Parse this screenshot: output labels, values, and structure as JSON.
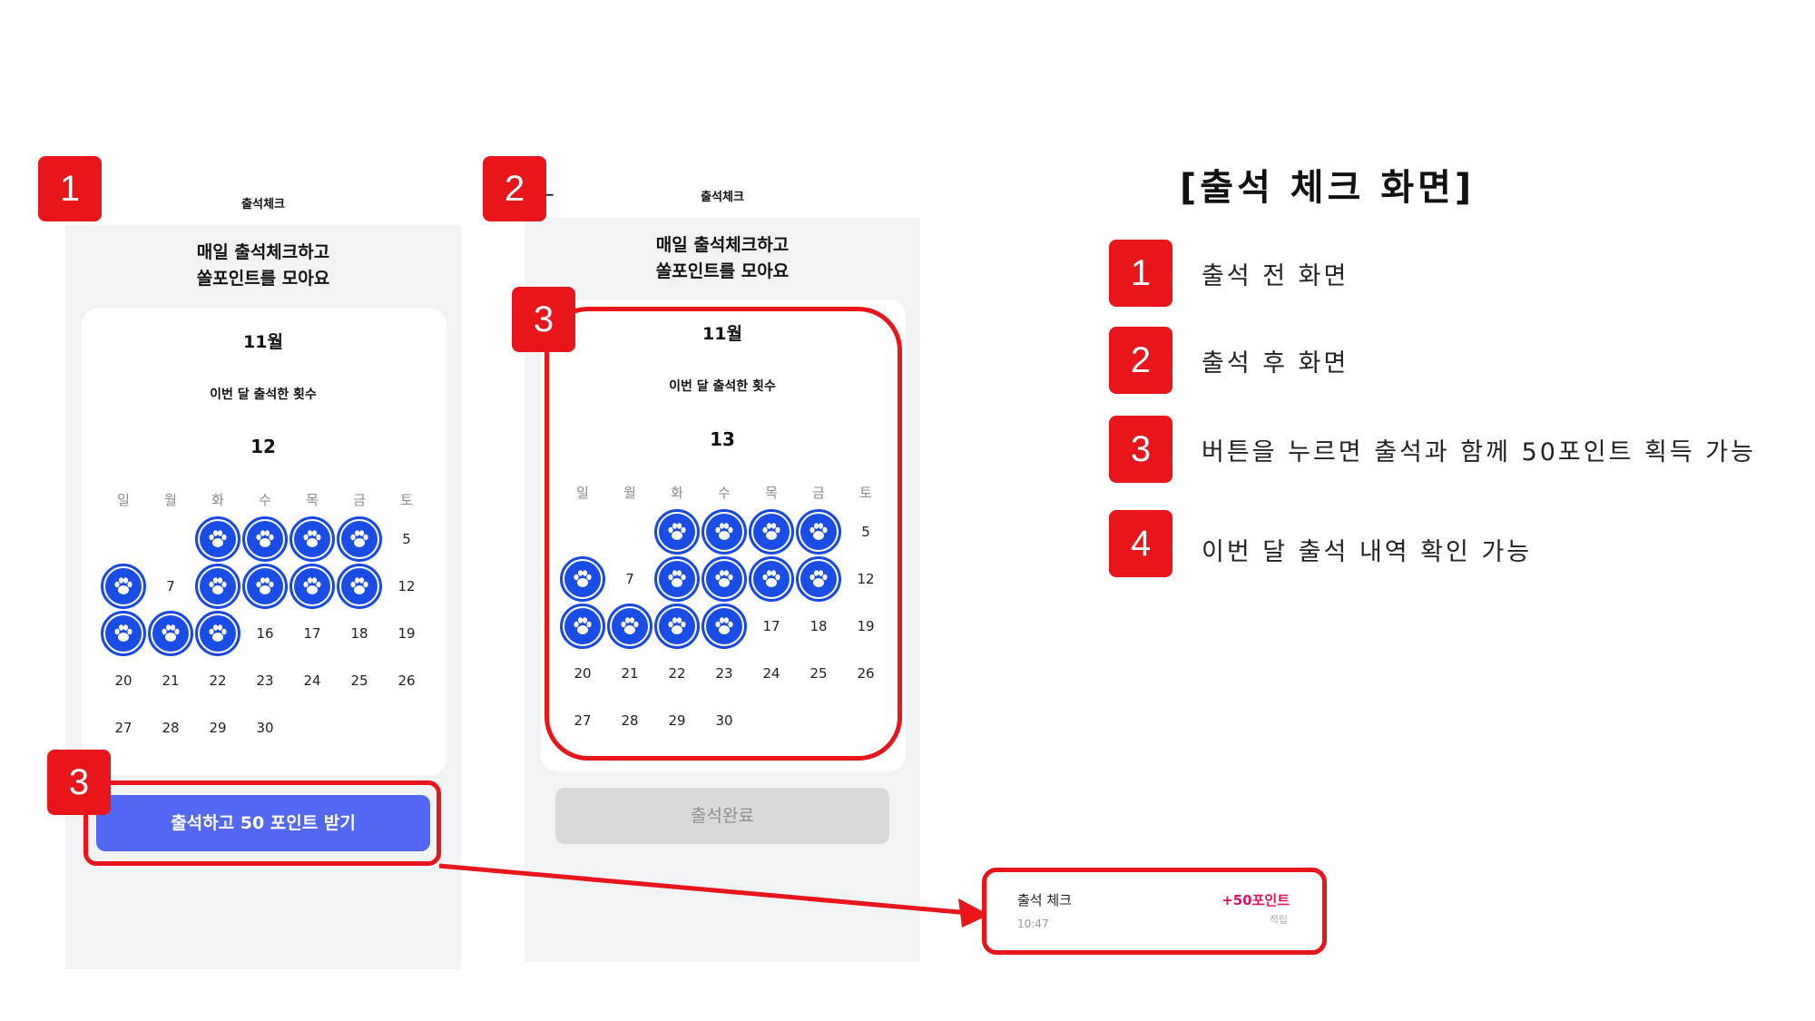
{
  "colors": {
    "accent_red": "#e8161b",
    "stamp_blue": "#1a4de6",
    "primary_button": "#5268f2",
    "done_button": "#d9d9db",
    "point_pink": "#e0155b"
  },
  "left_screen": {
    "title": "출석체크",
    "headline_line1": "매일 출석체크하고",
    "headline_line2": "쏠포인트를 모아요",
    "month": "11월",
    "subtitle": "이번 달 출석한 횟수",
    "count": "12",
    "button_label": "출석하고 50 포인트 받기"
  },
  "right_screen": {
    "title": "출석체크",
    "back_icon": "back-arrow-icon",
    "headline_line1": "매일 출석체크하고",
    "headline_line2": "쏠포인트를 모아요",
    "month": "11월",
    "subtitle": "이번 달 출석한 횟수",
    "count": "13",
    "button_label": "출석완료"
  },
  "calendar": {
    "weekdays": [
      "일",
      "월",
      "화",
      "수",
      "목",
      "금",
      "토"
    ],
    "days_left": [
      "",
      "",
      "1",
      "2",
      "3",
      "4",
      "5",
      "6",
      "7",
      "8",
      "9",
      "10",
      "11",
      "12",
      "13",
      "14",
      "15",
      "16",
      "17",
      "18",
      "19",
      "20",
      "21",
      "22",
      "23",
      "24",
      "25",
      "26",
      "27",
      "28",
      "29",
      "30",
      "",
      "",
      ""
    ],
    "attended_left": [
      2,
      3,
      4,
      5,
      7,
      9,
      10,
      11,
      12,
      14,
      15,
      16
    ],
    "attended_right": [
      2,
      3,
      4,
      5,
      7,
      9,
      10,
      11,
      12,
      14,
      15,
      16,
      17
    ],
    "stamp_icon": "paw-print-icon"
  },
  "badges": {
    "b1": "1",
    "b2": "2",
    "b3_right": "3",
    "b3_left": "3"
  },
  "legend": {
    "title": "[출석 체크 화면]",
    "items": [
      {
        "num": "1",
        "text": "출석 전 화면"
      },
      {
        "num": "2",
        "text": "출석 후 화면"
      },
      {
        "num": "3",
        "text": "버튼을 누르면 출석과 함께 50포인트 획득 가능"
      },
      {
        "num": "4",
        "text": "이번 달 출석 내역 확인 가능"
      }
    ]
  },
  "toast": {
    "title": "출석 체크",
    "time": "10:47",
    "points": "+50포인트",
    "status": "적립"
  }
}
